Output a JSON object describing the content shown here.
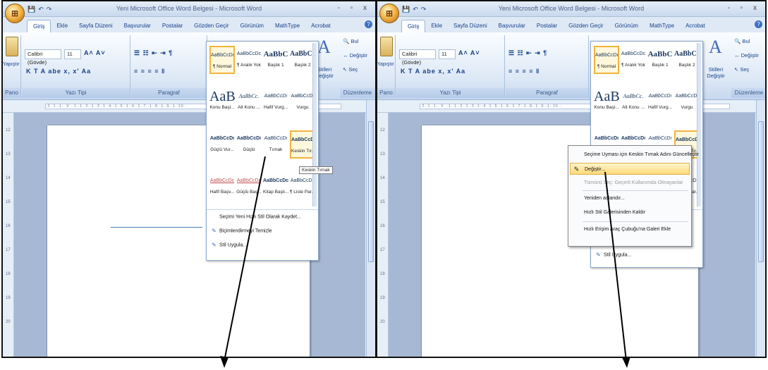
{
  "window": {
    "title": "Yeni Microsoft Office Word Belgesi - Microsoft Word",
    "office_button_glyph": "⊞",
    "window_buttons": "- ▫ x"
  },
  "tabs": [
    "Giriş",
    "Ekle",
    "Sayfa Düzeni",
    "Başvurular",
    "Postalar",
    "Gözden Geçir",
    "Görünüm",
    "MathType",
    "Acrobat"
  ],
  "ribbon": {
    "paste_label": "Yapıştır",
    "font_name": "Calibri (Gövde)",
    "font_size": "11",
    "format_row": "K T A abe x, x' Aa",
    "styles_label": "Stilleri Değiştir",
    "edit_find": "Bul",
    "edit_replace": "Değiştir",
    "edit_select": "Seç",
    "groups": {
      "clipboard": "Pano",
      "font": "Yazı Tipi",
      "paragraph": "Paragraf",
      "editing": "Düzenleme"
    }
  },
  "ruler_text": "·2··1··1·· X ··1··1··2··1··3··1··4··1··5··1··6··1··7··1··8··1··9··1··10··",
  "vertical_ruler_numbers": [
    "12",
    "13",
    "14",
    "15",
    "16",
    "17",
    "18",
    "19",
    "20"
  ],
  "style_gallery": {
    "rows": [
      [
        {
          "sample": "AaBbCcDc",
          "name": "¶ Normal",
          "selected": true
        },
        {
          "sample": "AaBbCcDc",
          "name": "¶ Aralık Yok"
        },
        {
          "sample": "AaBbC",
          "name": "Başlık 1"
        },
        {
          "sample": "AaBbCc",
          "name": "Başlık 2"
        }
      ],
      [
        {
          "sample": "AaB",
          "name": "Konu Başl..."
        },
        {
          "sample": "AaBbCc.",
          "name": "Alt Konu ..."
        },
        {
          "sample": "AaBbCcDı",
          "name": "Hafif Vurg..."
        },
        {
          "sample": "AaBbCcDı",
          "name": "Vurgu"
        }
      ],
      [
        {
          "sample": "AaBbCcDı",
          "name": "Güçlü Vur..."
        },
        {
          "sample": "AaBbCcDı",
          "name": "Güçlü"
        },
        {
          "sample": "AaBbCcDı",
          "name": "Tırnak"
        },
        {
          "sample": "AaBbCcDı",
          "name": "Keskin Tır...",
          "selected": true
        }
      ],
      [
        {
          "sample": "AaBbCcDc",
          "name": "Hafif Başv..."
        },
        {
          "sample": "AaBbCcDc",
          "name": "Güçlü Baş..."
        },
        {
          "sample": "AaBbCcDc",
          "name": "Kitap Başlı..."
        },
        {
          "sample": "AaBbCcDc",
          "name": "¶ Liste Par..."
        }
      ]
    ],
    "menu": [
      {
        "label": "Seçimi Yeni Hızlı Stil Olarak Kaydet...",
        "icon": ""
      },
      {
        "label": "Biçimlendirmeyi Temizle",
        "icon": "✎"
      },
      {
        "label": "Stil Uygula...",
        "icon": "✎"
      }
    ]
  },
  "tooltip": "Keskin Tırnak",
  "context_menu": [
    {
      "label": "Seçime Uyması için Keskin Tırnak Adını Güncelleştir",
      "state": "normal",
      "icon": ""
    },
    {
      "label": "Değiştir...",
      "state": "highlighted",
      "icon": "✎"
    },
    {
      "label": "Tümünü Seç: Geçerli Kullanımda Olmayanlar",
      "state": "disabled",
      "icon": ""
    },
    {
      "label": "Yeniden adlandır...",
      "state": "normal",
      "icon": ""
    },
    {
      "label": "Hızlı Stil Galerisinden Kaldır",
      "state": "normal",
      "icon": ""
    },
    {
      "label": "Hızlı Erişim Araç Çubuğu'na Galeri Ekle",
      "state": "normal",
      "icon": ""
    }
  ],
  "behind_menu": {
    "sample_right": "bCcDı",
    "name_right": "Tır...",
    "apply_item": "Stil Uygula..."
  },
  "colors": {
    "ribbon_text": "#15428b",
    "selection_border": "#f2b33c",
    "highlight": "#ffd97a",
    "arrow": "#000000"
  }
}
